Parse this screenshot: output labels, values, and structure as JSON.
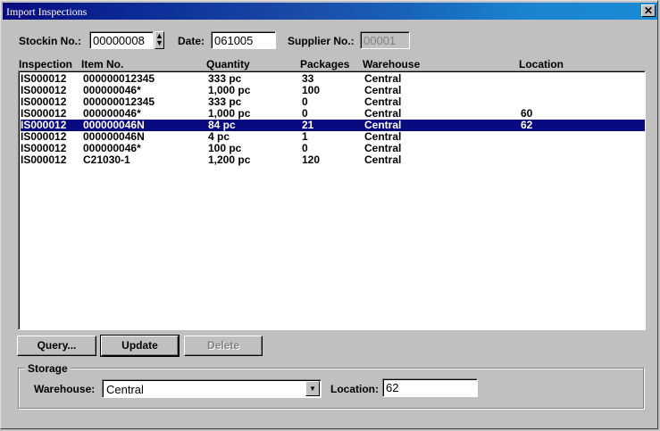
{
  "window": {
    "title": "Import Inspections",
    "close_glyph": "✕"
  },
  "header": {
    "stockin_label": "Stockin No.:",
    "stockin_value": "00000008",
    "date_label": "Date:",
    "date_value": "061005",
    "supplier_label": "Supplier No.:",
    "supplier_value": "00001"
  },
  "table": {
    "columns": [
      "Inspection",
      "Item No.",
      "Quantity",
      "Packages",
      "Warehouse",
      "Location"
    ],
    "rows": [
      [
        "IS000012",
        "000000012345",
        "333 pc",
        "33",
        "Central",
        ""
      ],
      [
        "IS000012",
        "000000046*",
        "1,000 pc",
        "100",
        "Central",
        ""
      ],
      [
        "IS000012",
        "000000012345",
        "333 pc",
        "0",
        "Central",
        ""
      ],
      [
        "IS000012",
        "000000046*",
        "1,000 pc",
        "0",
        "Central",
        "60"
      ],
      [
        "IS000012",
        "000000046N",
        "84 pc",
        "21",
        "Central",
        "62"
      ],
      [
        "IS000012",
        "000000046N",
        "4 pc",
        "1",
        "Central",
        ""
      ],
      [
        "IS000012",
        "000000046*",
        "100 pc",
        "0",
        "Central",
        ""
      ],
      [
        "IS000012",
        "C21030-1",
        "1,200 pc",
        "120",
        "Central",
        ""
      ]
    ],
    "selected_row": 4
  },
  "buttons": {
    "query": "Query...",
    "update": "Update",
    "delete": "Delete"
  },
  "storage": {
    "group_title": "Storage",
    "warehouse_label": "Warehouse:",
    "warehouse_value": "Central",
    "location_label": "Location:",
    "location_value": "62"
  },
  "icons": {
    "close": "close-icon",
    "spin": "spin-arrows-icon",
    "dropdown": "chevron-down-icon"
  },
  "colors": {
    "selection": "#0a0a80",
    "titlebar_start": "#0a0a80",
    "titlebar_end": "#1b8bd6"
  }
}
